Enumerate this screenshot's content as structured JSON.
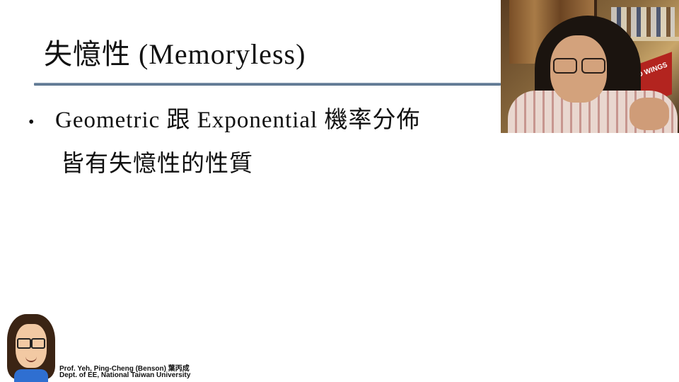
{
  "slide": {
    "title": "失憶性 (Memoryless)",
    "bullet_symbol": "•",
    "bullet_line1": "Geometric 跟 Exponential 機率分佈",
    "bullet_line2": "皆有失憶性的性質"
  },
  "footer": {
    "credit_line1": "Prof. Yeh, Ping-Cheng (Benson) 葉丙成",
    "credit_line2": "Dept. of EE,  National Taiwan University"
  },
  "webcam": {
    "pennant_text": "DETROIT RED WINGS"
  },
  "colors": {
    "title_rule": "#5e7794",
    "pennant": "#b3241f"
  }
}
